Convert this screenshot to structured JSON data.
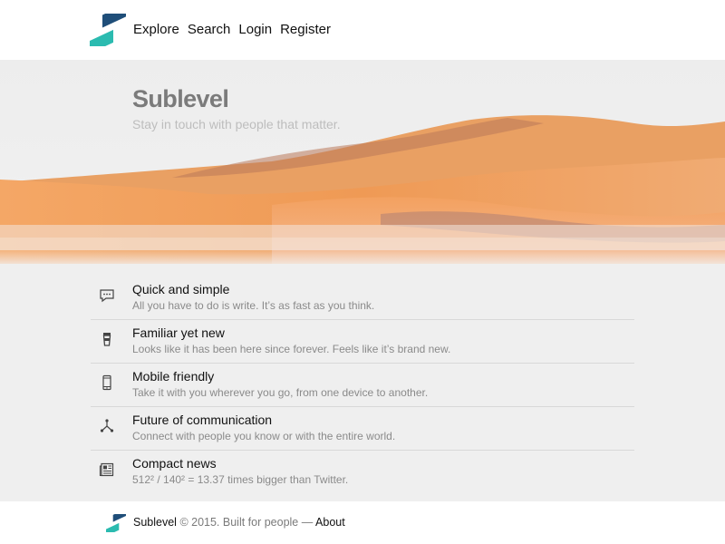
{
  "nav": {
    "items": [
      {
        "label": "Explore"
      },
      {
        "label": "Search"
      },
      {
        "label": "Login"
      },
      {
        "label": "Register"
      }
    ]
  },
  "hero": {
    "title": "Sublevel",
    "subtitle": "Stay in touch with people that matter."
  },
  "features": [
    {
      "icon": "chat-icon",
      "title": "Quick and simple",
      "description": "All you have to do is write. It’s as fast as you think."
    },
    {
      "icon": "cup-icon",
      "title": "Familiar yet new",
      "description": "Looks like it has been here since forever. Feels like it’s brand new."
    },
    {
      "icon": "phone-icon",
      "title": "Mobile friendly",
      "description": "Take it with you wherever you go, from one device to another."
    },
    {
      "icon": "share-icon",
      "title": "Future of communication",
      "description": "Connect with people you know or with the entire world."
    },
    {
      "icon": "newspaper-icon",
      "title": "Compact news",
      "description": "512² / 140² = 13.37 times bigger than Twitter."
    }
  ],
  "footer": {
    "brand": "Sublevel",
    "copyright": "© 2015. Built for people —",
    "about_label": "About"
  },
  "colors": {
    "logo_dark": "#1f4e79",
    "logo_teal": "#2bbbb0",
    "sand": "#f0a05a",
    "background": "#efefef"
  }
}
